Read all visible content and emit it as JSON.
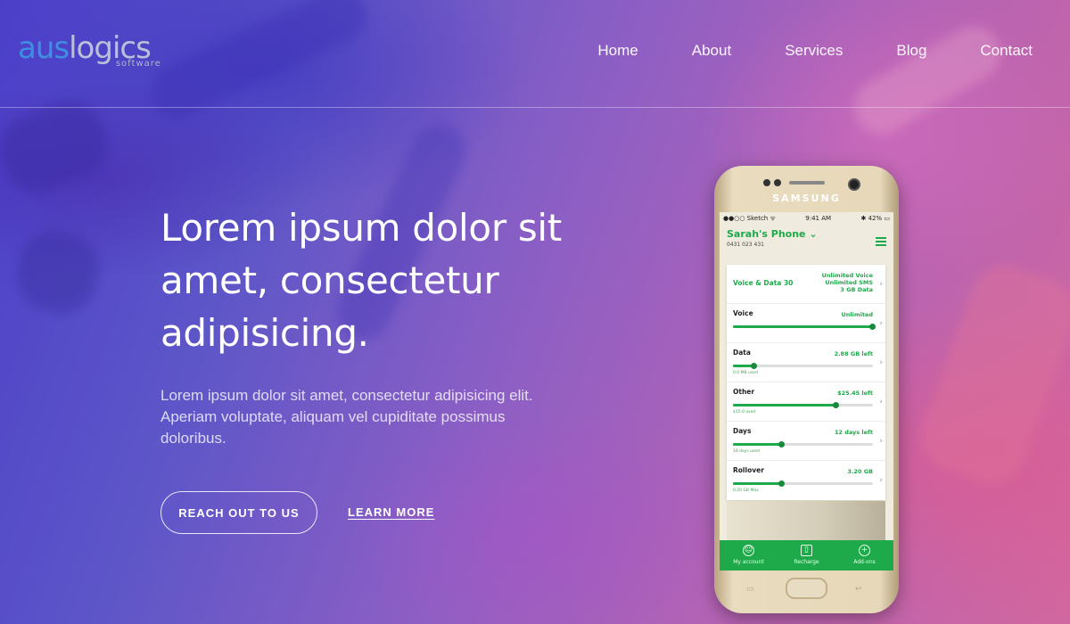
{
  "header": {
    "logo": {
      "prefix": "aus",
      "suffix": "logics",
      "sub": "software"
    },
    "nav": [
      "Home",
      "About",
      "Services",
      "Blog",
      "Contact"
    ]
  },
  "hero": {
    "title": "Lorem ipsum dolor sit amet, consectetur adipisicing.",
    "text": "Lorem ipsum dolor sit amet, consectetur adipisicing elit. Aperiam voluptate, aliquam vel cupiditate possimus doloribus.",
    "reach_button": "REACH OUT TO US",
    "learn_link": "LEARN MORE"
  },
  "phone": {
    "brand": "SAMSUNG",
    "status": {
      "carrier": "●●○○ Sketch ᯤ",
      "time": "9:41 AM",
      "battery": "✱ 42% ▭"
    },
    "account_name": "Sarah's Phone ⌄",
    "account_number": "0431 023 431",
    "plan": {
      "label": "Voice & Data 30",
      "details": [
        "Unlimited Voice",
        "Unlimited SMS",
        "3 GB Data"
      ]
    },
    "usage": [
      {
        "label": "Voice",
        "value": "Unlimited",
        "fill": 1.0,
        "small": ""
      },
      {
        "label": "Data",
        "value": "2.88 GB left",
        "fill": 0.15,
        "small": "0.0 MB used"
      },
      {
        "label": "Other",
        "value": "$25.45 left",
        "fill": 0.74,
        "small": "$15.0 used"
      },
      {
        "label": "Days",
        "value": "12 days left",
        "fill": 0.35,
        "small": "16 days used"
      },
      {
        "label": "Rollover",
        "value": "3.20 GB",
        "fill": 0.35,
        "small": "0.20 GB Max"
      }
    ],
    "tabs": [
      {
        "label": "My account",
        "icon": "user-icon"
      },
      {
        "label": "Recharge",
        "icon": "phone-icon"
      },
      {
        "label": "Add-ons",
        "icon": "plus-icon"
      }
    ]
  }
}
